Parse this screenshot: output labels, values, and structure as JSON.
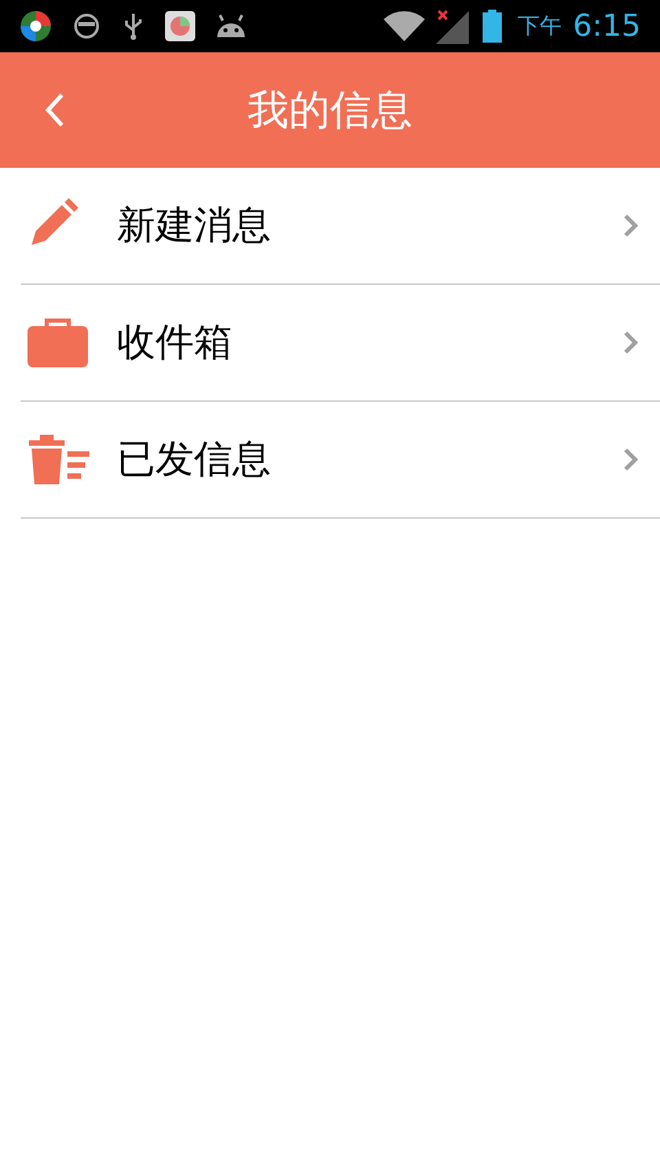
{
  "status_bar": {
    "period": "下午",
    "time": "6:15"
  },
  "header": {
    "title": "我的信息"
  },
  "menu": [
    {
      "label": "新建消息",
      "kind": "compose"
    },
    {
      "label": "收件箱",
      "kind": "inbox"
    },
    {
      "label": "已发信息",
      "kind": "sent"
    }
  ]
}
